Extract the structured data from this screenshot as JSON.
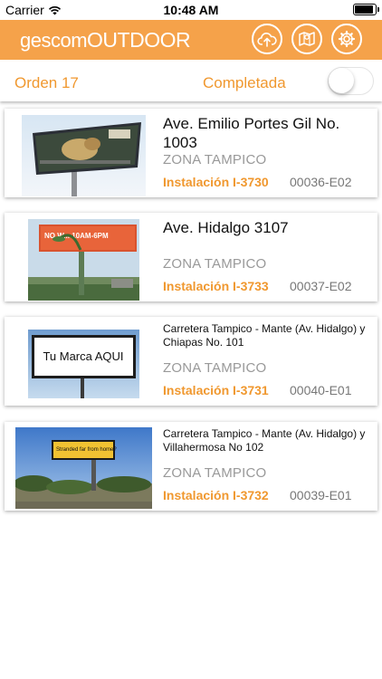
{
  "status_bar": {
    "carrier": "Carrier",
    "time": "10:48 AM"
  },
  "app": {
    "logo_part1": "gescom",
    "logo_part2": "OUTDOOR",
    "accent_color": "#f5a24a",
    "nav_icons": [
      "cloud-upload-icon",
      "map-icon",
      "gear-icon"
    ]
  },
  "order": {
    "title": "Orden 17",
    "status": "Completada",
    "toggle_on": false
  },
  "items": [
    {
      "address": "Ave. Emilio Portes Gil No. 1003",
      "zone": "ZONA TAMPICO",
      "installation": "Instalación I-3730",
      "code": "00036-E02"
    },
    {
      "address": "Ave. Hidalgo 3107",
      "zone": "ZONA TAMPICO",
      "installation": "Instalación I-3733",
      "code": "00037-E02",
      "billboard_text": "NO W... 10AM-6PM"
    },
    {
      "address": "Carretera Tampico - Mante (Av. Hidalgo) y Chiapas No. 101",
      "zone": "ZONA TAMPICO",
      "installation": "Instalación I-3731",
      "code": "00040-E01",
      "billboard_text": "Tu Marca AQUI"
    },
    {
      "address": "Carretera Tampico - Mante (Av. Hidalgo) y Villahermosa No 102",
      "zone": "ZONA TAMPICO",
      "installation": "Instalación I-3732",
      "code": "00039-E01",
      "billboard_text": "Stranded far from home?"
    }
  ]
}
